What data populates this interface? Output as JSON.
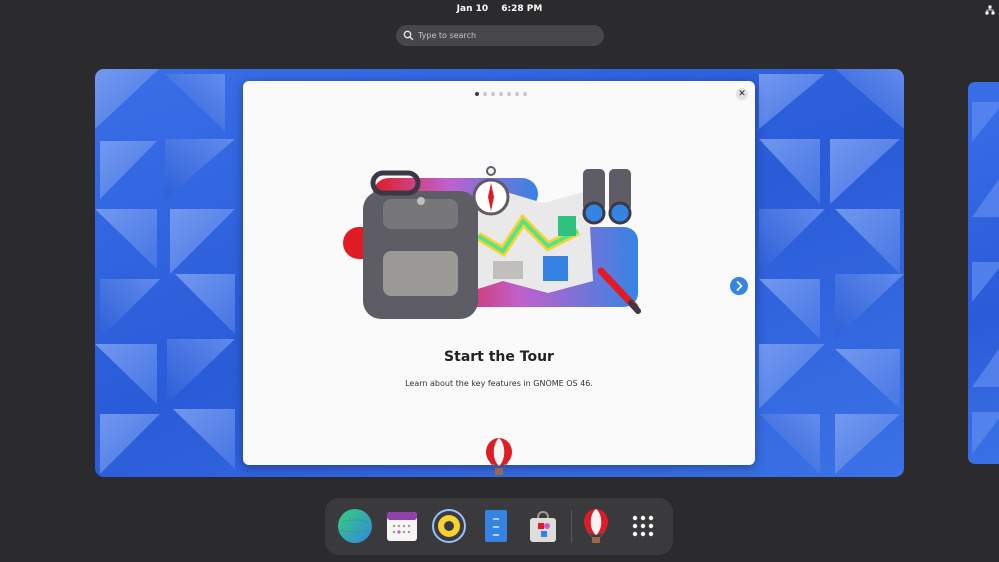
{
  "topbar": {
    "date": "Jan 10",
    "time": "6:28 PM",
    "network_icon": "network-wired-icon"
  },
  "search": {
    "placeholder": "Type to search",
    "icon": "search-icon"
  },
  "tour": {
    "title": "Start the Tour",
    "description": "Learn about the key features in GNOME OS 46.",
    "page_count": 7,
    "current_page": 1,
    "close_icon": "close-icon",
    "next_icon": "chevron-right-icon"
  },
  "dash": {
    "apps": [
      {
        "name": "web-browser-app",
        "icon": "globe-icon"
      },
      {
        "name": "calendar-app",
        "icon": "calendar-icon"
      },
      {
        "name": "music-app",
        "icon": "speaker-icon"
      },
      {
        "name": "files-app",
        "icon": "file-cabinet-icon"
      },
      {
        "name": "software-app",
        "icon": "shopping-bag-icon"
      },
      {
        "name": "tour-app",
        "icon": "hot-air-balloon-icon"
      },
      {
        "name": "show-apps",
        "icon": "app-grid-icon"
      }
    ]
  },
  "colors": {
    "accent": "#3584e4",
    "panel_bg": "#2b2b2d",
    "dash_bg": "#3a3a3c",
    "wallpaper_blue": "#2f63dc"
  }
}
